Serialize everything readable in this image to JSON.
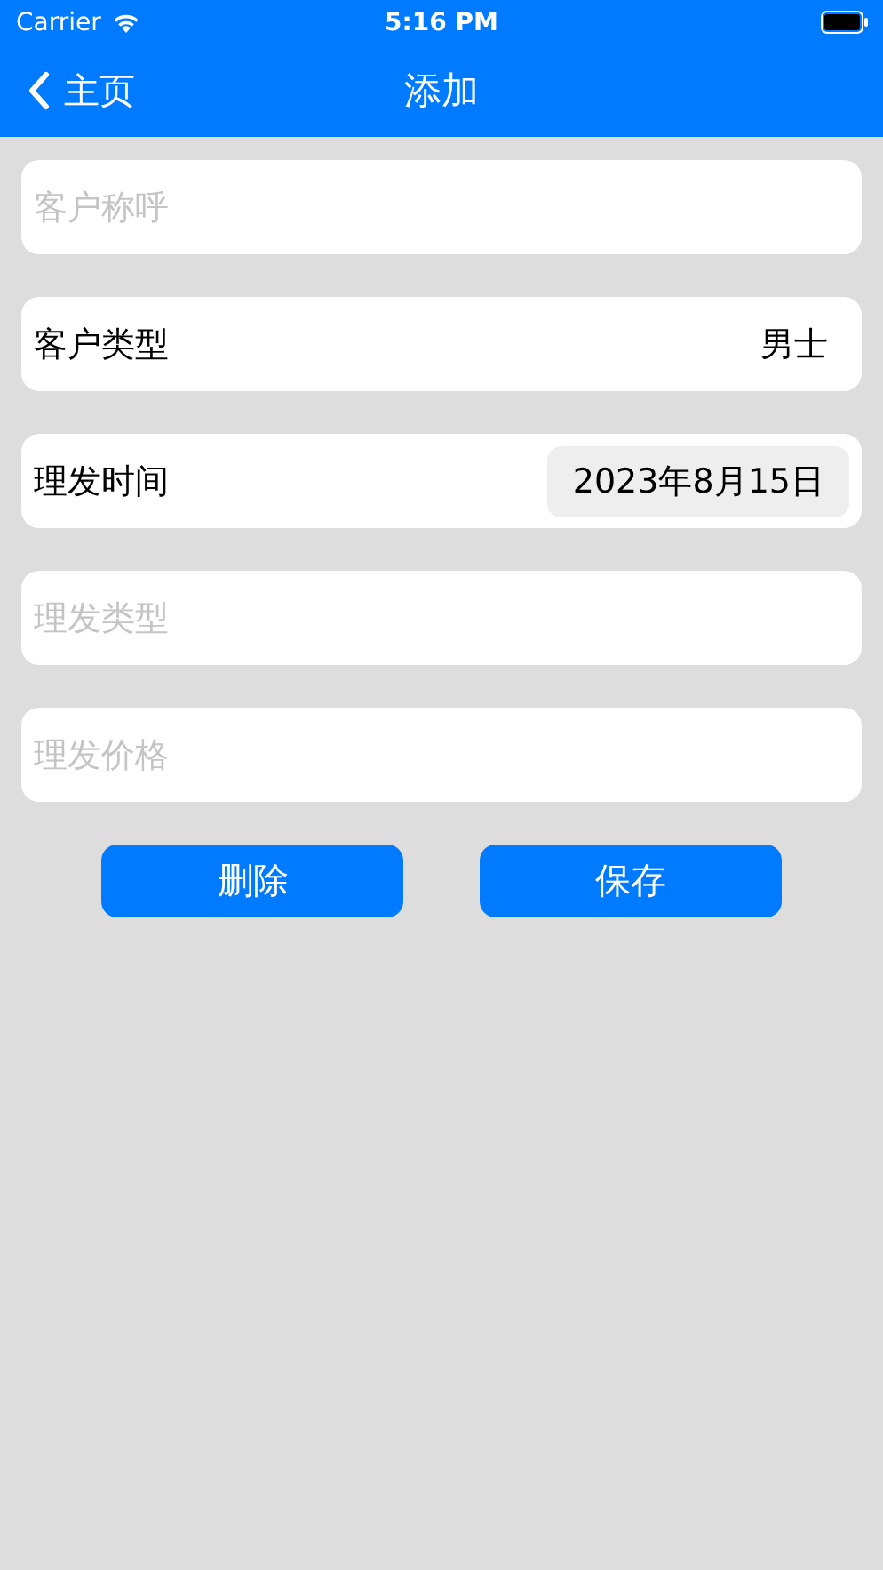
{
  "status_bar": {
    "carrier": "Carrier",
    "time": "5:16 PM"
  },
  "nav": {
    "back_label": "主页",
    "title": "添加"
  },
  "fields": [
    {
      "kind": "input",
      "placeholder": "客户称呼"
    },
    {
      "kind": "select",
      "label": "客户类型",
      "value": "男士"
    },
    {
      "kind": "date",
      "label": "理发时间",
      "value": "2023年8月15日"
    },
    {
      "kind": "input",
      "placeholder": "理发类型"
    },
    {
      "kind": "input",
      "placeholder": "理发价格"
    }
  ],
  "buttons": [
    "删除",
    "保存"
  ]
}
